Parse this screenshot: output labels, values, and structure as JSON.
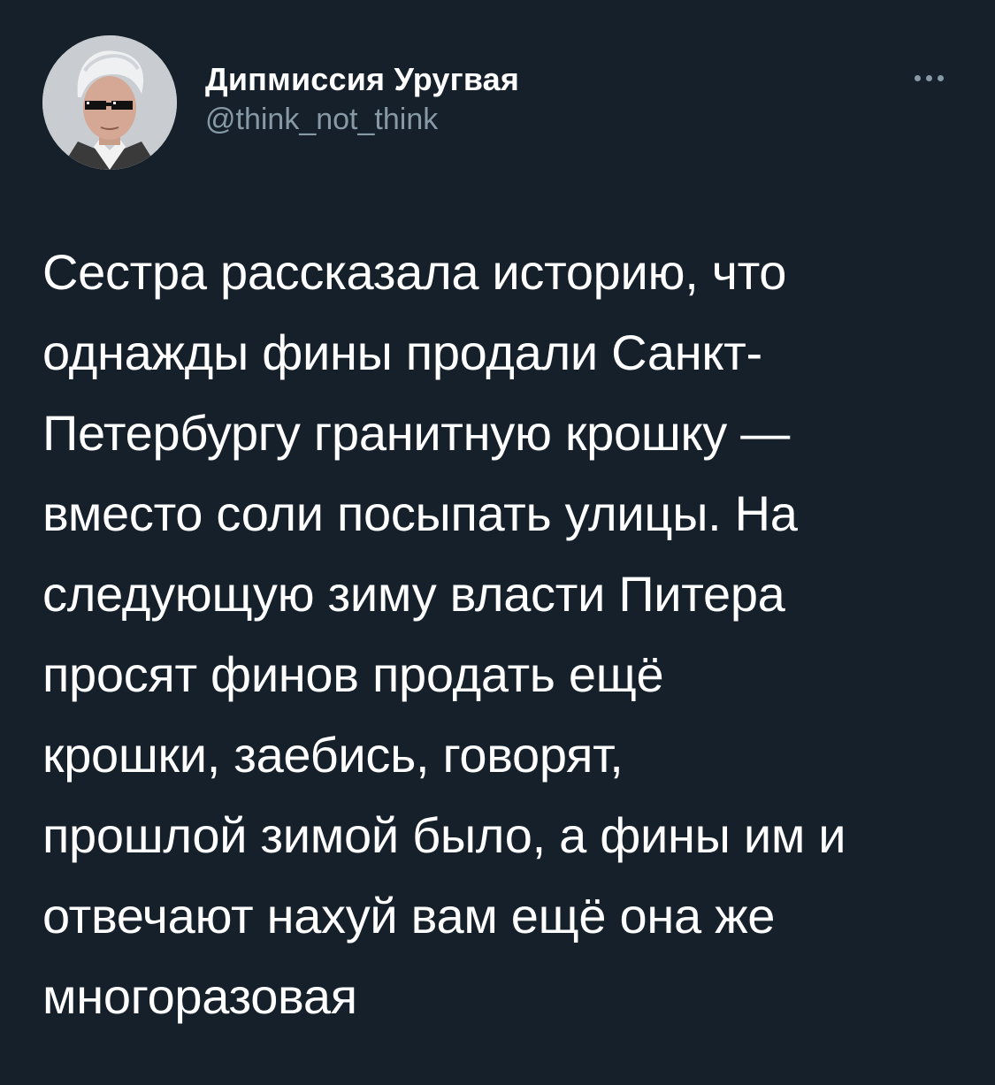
{
  "author": {
    "display_name": "Дипмиссия Уругвая",
    "handle": "@think_not_think",
    "avatar_icon": "profile-avatar"
  },
  "menu": {
    "icon": "more-options-icon"
  },
  "tweet": {
    "text": "Сестра рассказала историю, что\nоднажды фины продали Санкт-\nПетербургу гранитную крошку —\nвместо соли посыпать улицы. На\nследующую зиму власти Питера\nпросят финов продать ещё\nкрошки, заебись, говорят,\nпрошлой зимой было, а фины им и\nотвечают нахуй вам ещё она же\nмногоразовая"
  },
  "colors": {
    "background": "#15202b",
    "text_primary": "#ffffff",
    "text_secondary": "#8899a6"
  }
}
